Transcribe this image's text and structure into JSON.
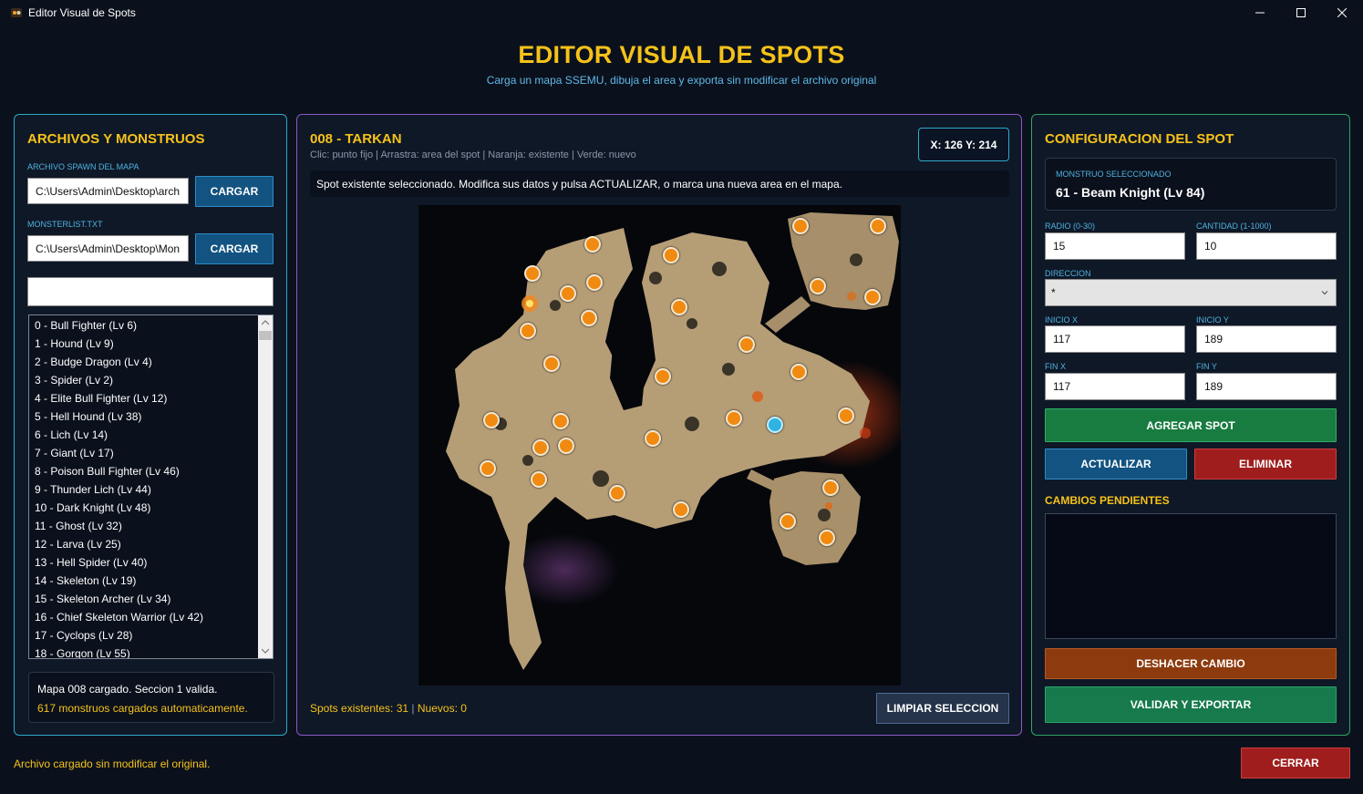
{
  "window": {
    "title": "Editor Visual de Spots",
    "minimize": "—",
    "maximize": "☐",
    "close": "✕"
  },
  "header": {
    "title": "EDITOR VISUAL DE SPOTS",
    "subtitle": "Carga un mapa SSEMU, dibuja el area y exporta sin modificar el archivo original"
  },
  "left": {
    "heading": "ARCHIVOS Y MONSTRUOS",
    "spawn_label": "ARCHIVO SPAWN DEL MAPA",
    "spawn_value": "C:\\Users\\Admin\\Desktop\\arch",
    "monsterlist_label": "MONSTERLIST.TXT",
    "monsterlist_value": "C:\\Users\\Admin\\Desktop\\Mon",
    "load_label": "CARGAR",
    "search_value": "",
    "monsters": [
      "0 - Bull Fighter (Lv 6)",
      "1 - Hound (Lv 9)",
      "2 - Budge Dragon (Lv 4)",
      "3 - Spider (Lv 2)",
      "4 - Elite Bull Fighter (Lv 12)",
      "5 - Hell Hound (Lv 38)",
      "6 - Lich (Lv 14)",
      "7 - Giant (Lv 17)",
      "8 - Poison Bull Fighter (Lv 46)",
      "9 - Thunder Lich (Lv 44)",
      "10 - Dark Knight (Lv 48)",
      "11 - Ghost (Lv 32)",
      "12 - Larva (Lv 25)",
      "13 - Hell Spider (Lv 40)",
      "14 - Skeleton (Lv 19)",
      "15 - Skeleton Archer (Lv 34)",
      "16 - Chief Skeleton Warrior (Lv 42)",
      "17 - Cyclops (Lv 28)",
      "18 - Gorgon (Lv 55)"
    ],
    "status_line1": "Mapa 008 cargado. Seccion 1 valida.",
    "status_line2": "617 monstruos cargados automaticamente."
  },
  "center": {
    "map_title": "008 - TARKAN",
    "hint": "Clic: punto fijo | Arrastra: area del spot | Naranja: existente | Verde: nuevo",
    "coords": "X: 126  Y: 214",
    "info": "Spot existente seleccionado. Modifica sus datos y pulsa ACTUALIZAR, o marca una nueva area en el mapa.",
    "counts_existing": "Spots existentes: 31",
    "counts_sep": " | ",
    "counts_new": "Nuevos: 0",
    "clear_label": "LIMPIAR SELECCION"
  },
  "right": {
    "heading": "CONFIGURACION DEL SPOT",
    "selected_label": "MONSTRUO SELECCIONADO",
    "selected_value": "61 - Beam Knight (Lv 84)",
    "radio_label": "RADIO (0-30)",
    "radio_value": "15",
    "cantidad_label": "CANTIDAD (1-1000)",
    "cantidad_value": "10",
    "direccion_label": "DIRECCION",
    "direccion_value": "*",
    "inicio_x_label": "INICIO X",
    "inicio_x_value": "117",
    "inicio_y_label": "INICIO Y",
    "inicio_y_value": "189",
    "fin_x_label": "FIN X",
    "fin_x_value": "117",
    "fin_y_label": "FIN Y",
    "fin_y_value": "189",
    "add_label": "AGREGAR SPOT",
    "update_label": "ACTUALIZAR",
    "delete_label": "ELIMINAR",
    "pending_heading": "CAMBIOS PENDIENTES",
    "undo_label": "DESHACER CAMBIO",
    "export_label": "VALIDAR Y EXPORTAR"
  },
  "footer": {
    "status": "Archivo cargado sin modificar el original.",
    "close_label": "CERRAR"
  },
  "colors": {
    "accent_gold": "#f6c21a",
    "accent_blue": "#4fb3e0",
    "spot_existing": "#f08a10",
    "spot_selected": "#2fb4e2"
  }
}
